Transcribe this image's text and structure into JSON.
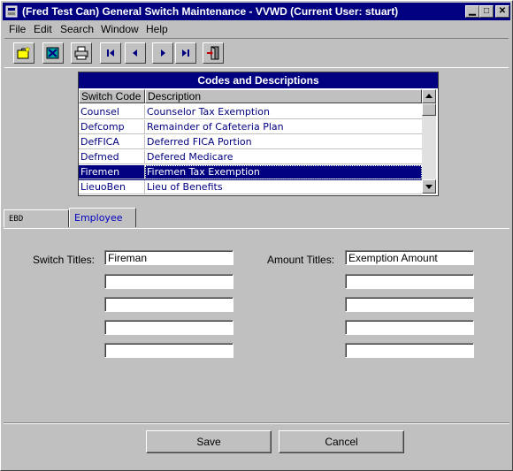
{
  "window": {
    "title": "(Fred Test Can) General Switch Maintenance - VVWD (Current User: stuart)"
  },
  "menu": [
    {
      "label": "File"
    },
    {
      "label": "Edit"
    },
    {
      "label": "Search"
    },
    {
      "label": "Window"
    },
    {
      "label": "Help"
    }
  ],
  "toolbar": [
    {
      "icon": "new-record-icon"
    },
    {
      "icon": "delete-record-icon"
    },
    {
      "icon": "print-icon"
    },
    {
      "icon": "first-record-icon"
    },
    {
      "icon": "previous-record-icon"
    },
    {
      "icon": "next-record-icon"
    },
    {
      "icon": "last-record-icon"
    },
    {
      "icon": "exit-icon"
    }
  ],
  "grid": {
    "title": "Codes and Descriptions",
    "columns": [
      "Switch Code",
      "Description"
    ],
    "rows": [
      {
        "code": "Counsel",
        "desc": "Counselor Tax Exemption"
      },
      {
        "code": "Defcomp",
        "desc": "Remainder of Cafeteria Plan"
      },
      {
        "code": "DefFICA",
        "desc": "Deferred FICA Portion"
      },
      {
        "code": "Defmed",
        "desc": "Defered Medicare"
      },
      {
        "code": "Firemen",
        "desc": "Firemen Tax Exemption"
      },
      {
        "code": "LieuoBen",
        "desc": "Lieu of Benefits"
      }
    ],
    "selected_index": 4
  },
  "tabs": [
    {
      "label": "EBD"
    },
    {
      "label": "Employee"
    }
  ],
  "form": {
    "switch_titles_label": "Switch Titles:",
    "amount_titles_label": "Amount Titles:",
    "switch_titles": [
      "Fireman",
      "",
      "",
      "",
      ""
    ],
    "amount_titles": [
      "Exemption Amount",
      "",
      "",
      "",
      ""
    ]
  },
  "buttons": {
    "save": "Save",
    "cancel": "Cancel"
  },
  "colors": {
    "title_bar": "#000080",
    "selected_row": "#000080",
    "active_tab_text": "#0000c0"
  }
}
